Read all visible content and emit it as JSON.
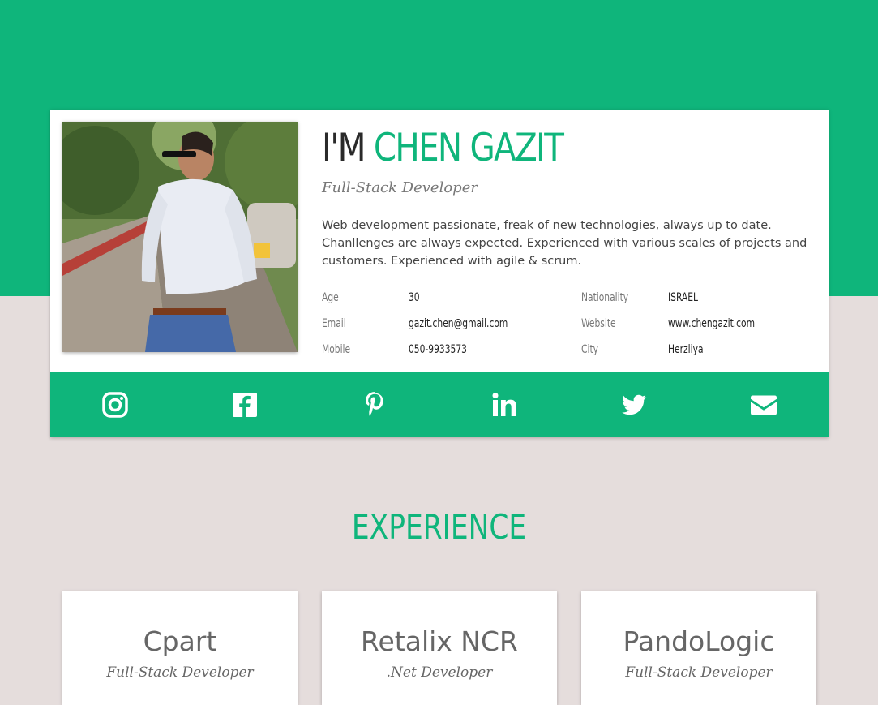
{
  "profile": {
    "headline_prefix": "I'M",
    "name": "CHEN GAZIT",
    "role": "Full-Stack Developer",
    "bio": "Web development passionate, freak of new technologies, always up to date. Chanllenges are always expected. Experienced with various scales of projects and customers. Experienced with agile & scrum.",
    "info": {
      "age_label": "Age",
      "age": "30",
      "email_label": "Email",
      "email": "gazit.chen@gmail.com",
      "mobile_label": "Mobile",
      "mobile": "050-9933573",
      "nationality_label": "Nationality",
      "nationality": "ISRAEL",
      "website_label": "Website",
      "website": "www.chengazit.com",
      "city_label": "City",
      "city": "Herzliya"
    }
  },
  "social": [
    "instagram-icon",
    "facebook-icon",
    "pinterest-icon",
    "linkedin-icon",
    "twitter-icon",
    "email-icon"
  ],
  "experience": {
    "title": "EXPERIENCE",
    "items": [
      {
        "company": "Cpart",
        "role": "Full-Stack Developer"
      },
      {
        "company": "Retalix NCR",
        "role": ".Net Developer"
      },
      {
        "company": "PandoLogic",
        "role": "Full-Stack Developer"
      }
    ]
  },
  "colors": {
    "accent": "#0fb57b",
    "background": "#e5dddc",
    "card": "#ffffff"
  }
}
